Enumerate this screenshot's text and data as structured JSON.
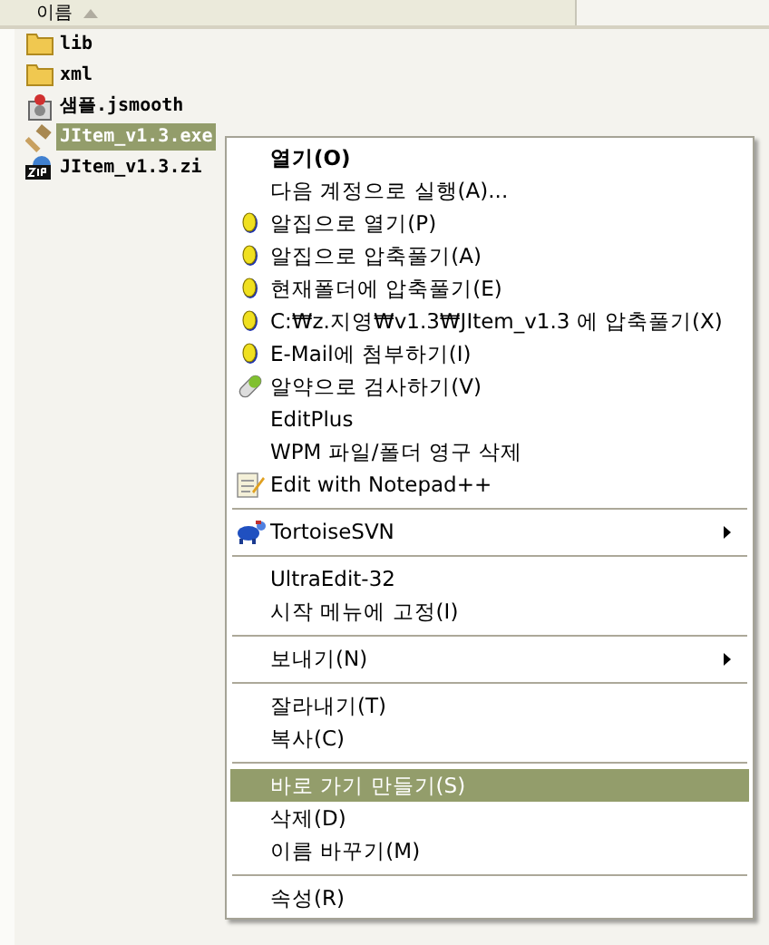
{
  "header": {
    "column_1": "이름"
  },
  "files": [
    {
      "name": "lib",
      "kind": "folder",
      "selected": false
    },
    {
      "name": "xml",
      "kind": "folder",
      "selected": false
    },
    {
      "name": "샘플.jsmooth",
      "kind": "jsmooth",
      "selected": false
    },
    {
      "name": "JItem_v1.3.exe",
      "kind": "hammer",
      "selected": true
    },
    {
      "name": "JItem_v1.3.zi",
      "kind": "zip",
      "selected": false
    }
  ],
  "context_menu": [
    {
      "kind": "item",
      "label": "열기(O)",
      "default": true,
      "selected": false
    },
    {
      "kind": "item",
      "label": "다음 계정으로 실행(A)...",
      "selected": false
    },
    {
      "kind": "coin",
      "label": "알집으로 열기(P)",
      "selected": false
    },
    {
      "kind": "coin",
      "label": "알집으로 압축풀기(A)",
      "selected": false
    },
    {
      "kind": "coin",
      "label": "현재폴더에 압축풀기(E)",
      "selected": false
    },
    {
      "kind": "coin",
      "label": "C:₩z.지영₩v1.3₩JItem_v1.3 에 압축풀기(X)",
      "selected": false
    },
    {
      "kind": "coin",
      "label": "E-Mail에 첨부하기(I)",
      "selected": false
    },
    {
      "kind": "pill",
      "label": "알약으로 검사하기(V)",
      "selected": false
    },
    {
      "kind": "item",
      "label": "EditPlus",
      "selected": false
    },
    {
      "kind": "item",
      "label": "WPM 파일/폴더 영구 삭제",
      "selected": false
    },
    {
      "kind": "notepad",
      "label": "Edit with Notepad++",
      "selected": false
    },
    {
      "kind": "separator"
    },
    {
      "kind": "turtle",
      "label": "TortoiseSVN",
      "submenu": true,
      "selected": false
    },
    {
      "kind": "separator"
    },
    {
      "kind": "item",
      "label": "UltraEdit-32",
      "selected": false
    },
    {
      "kind": "item",
      "label": "시작 메뉴에 고정(I)",
      "selected": false
    },
    {
      "kind": "separator"
    },
    {
      "kind": "item",
      "label": "보내기(N)",
      "submenu": true,
      "selected": false
    },
    {
      "kind": "separator"
    },
    {
      "kind": "item",
      "label": "잘라내기(T)",
      "selected": false
    },
    {
      "kind": "item",
      "label": "복사(C)",
      "selected": false
    },
    {
      "kind": "separator"
    },
    {
      "kind": "item",
      "label": "바로 가기 만들기(S)",
      "selected": true
    },
    {
      "kind": "item",
      "label": "삭제(D)",
      "selected": false
    },
    {
      "kind": "item",
      "label": "이름 바꾸기(M)",
      "selected": false
    },
    {
      "kind": "separator"
    },
    {
      "kind": "item",
      "label": "속성(R)",
      "selected": false
    }
  ]
}
